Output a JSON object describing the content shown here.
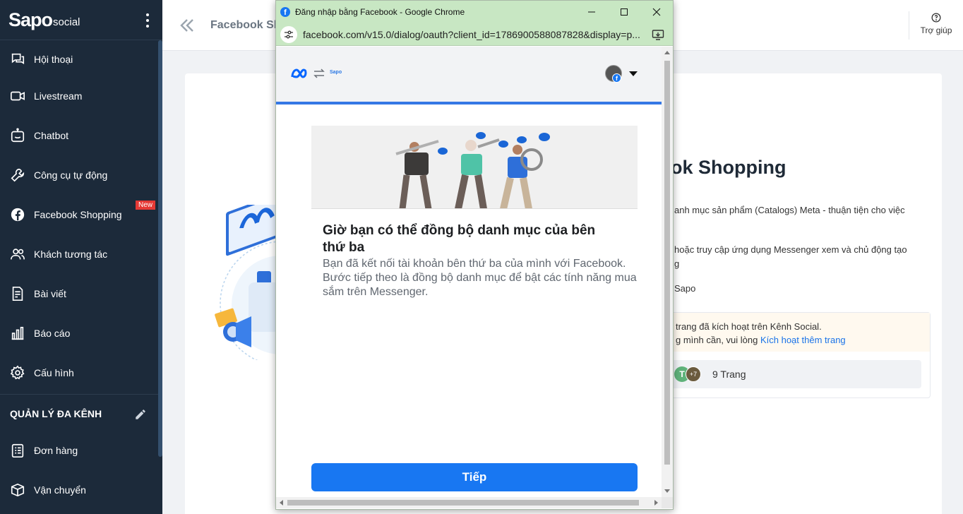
{
  "sidebar": {
    "logo_main": "Sapo",
    "logo_sub": "social",
    "items": [
      {
        "label": "Hội thoại",
        "icon": "chat-bubbles-icon"
      },
      {
        "label": "Livestream",
        "icon": "video-camera-icon"
      },
      {
        "label": "Chatbot",
        "icon": "chatbot-icon"
      },
      {
        "label": "Công cụ tự động",
        "icon": "wrench-icon"
      },
      {
        "label": "Facebook Shopping",
        "icon": "facebook-icon",
        "badge": "New"
      },
      {
        "label": "Khách tương tác",
        "icon": "users-icon"
      },
      {
        "label": "Bài viết",
        "icon": "document-edit-icon"
      },
      {
        "label": "Báo cáo",
        "icon": "bar-chart-icon"
      },
      {
        "label": "Cấu hình",
        "icon": "gear-icon"
      }
    ],
    "section_title": "QUẢN LÝ ĐA KÊNH",
    "section_items": [
      {
        "label": "Đơn hàng",
        "icon": "order-list-icon"
      },
      {
        "label": "Vận chuyển",
        "icon": "shipping-icon"
      }
    ]
  },
  "header": {
    "title": "Facebook Shopping",
    "help_label": "Trợ giúp"
  },
  "main": {
    "heading": "ok Shopping",
    "desc_1": "anh mục sản phẩm (Catalogs) Meta - thuận tiện cho việc",
    "desc_2": "hoặc truy cập ứng dụng Messenger xem và chủ động tạo",
    "desc_2b": "g",
    "desc_3": "Sapo",
    "notice_1": " trang đã kích hoạt trên Kênh Social.",
    "notice_2": "g mình cần, vui lòng ",
    "notice_link": "Kích hoạt thêm trang",
    "avatar_letter": "T",
    "avatar_more": "+7",
    "pages_count": "9 Trang"
  },
  "popup": {
    "window_title": "Đăng nhập bằng Facebook - Google Chrome",
    "url": "facebook.com/v15.0/dialog/oauth?client_id=1786900588087828&display=p...",
    "fb_letter": "f",
    "app_mini_logo": "Sapo",
    "progress": 1.0,
    "title": "Giờ bạn có thể đồng bộ danh mục của bên thứ ba",
    "body": "Bạn đã kết nối tài khoản bên thứ ba của mình với Facebook. Bước tiếp theo là đồng bộ danh mục để bật các tính năng mua sắm trên Messenger.",
    "next_label": "Tiếp"
  },
  "colors": {
    "sidebar_bg": "#1c2a3a",
    "chrome_green": "#c8e7c3",
    "facebook_blue": "#1877f2",
    "badge_red": "#e53935"
  }
}
